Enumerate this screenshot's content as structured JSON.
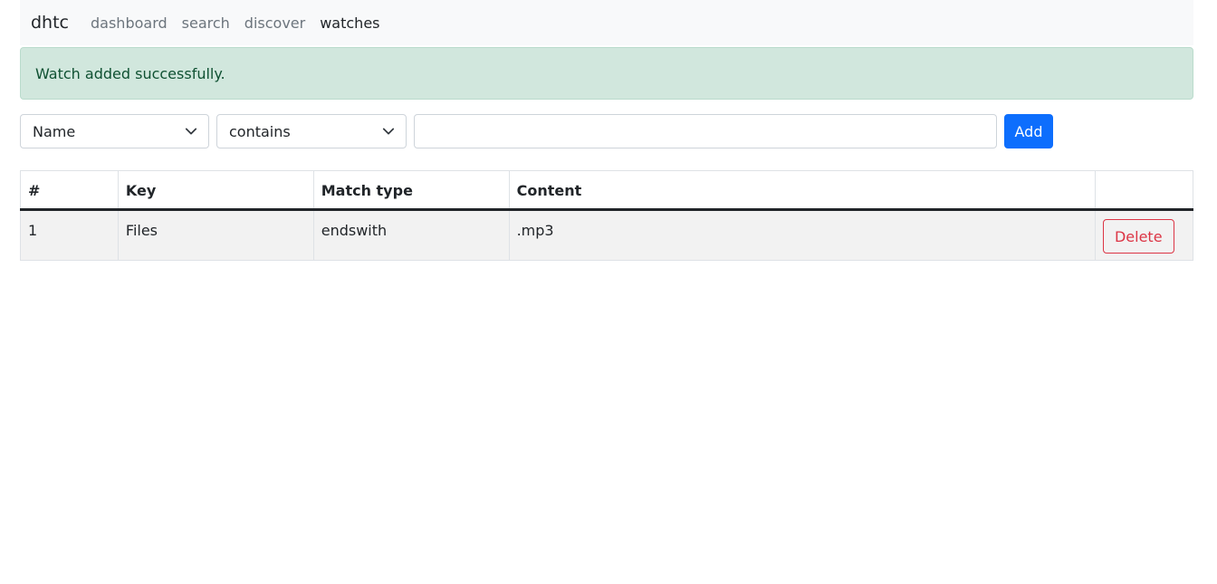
{
  "nav": {
    "brand": "dhtc",
    "links": [
      {
        "label": "dashboard",
        "active": false
      },
      {
        "label": "search",
        "active": false
      },
      {
        "label": "discover",
        "active": false
      },
      {
        "label": "watches",
        "active": true
      }
    ]
  },
  "alert": {
    "message": "Watch added successfully.",
    "color": "#d1e7dd"
  },
  "form": {
    "key_select": "Name",
    "match_select": "contains",
    "content_value": "",
    "content_placeholder": "",
    "add_label": "Add",
    "add_color": "#0d6efd"
  },
  "table": {
    "headers": [
      "#",
      "Key",
      "Match type",
      "Content",
      ""
    ],
    "rows": [
      {
        "num": "1",
        "key": "Files",
        "match_type": "endswith",
        "content": ".mp3",
        "action": "Delete"
      }
    ]
  },
  "icons": {
    "select_chevron": "chevron-down-icon"
  }
}
